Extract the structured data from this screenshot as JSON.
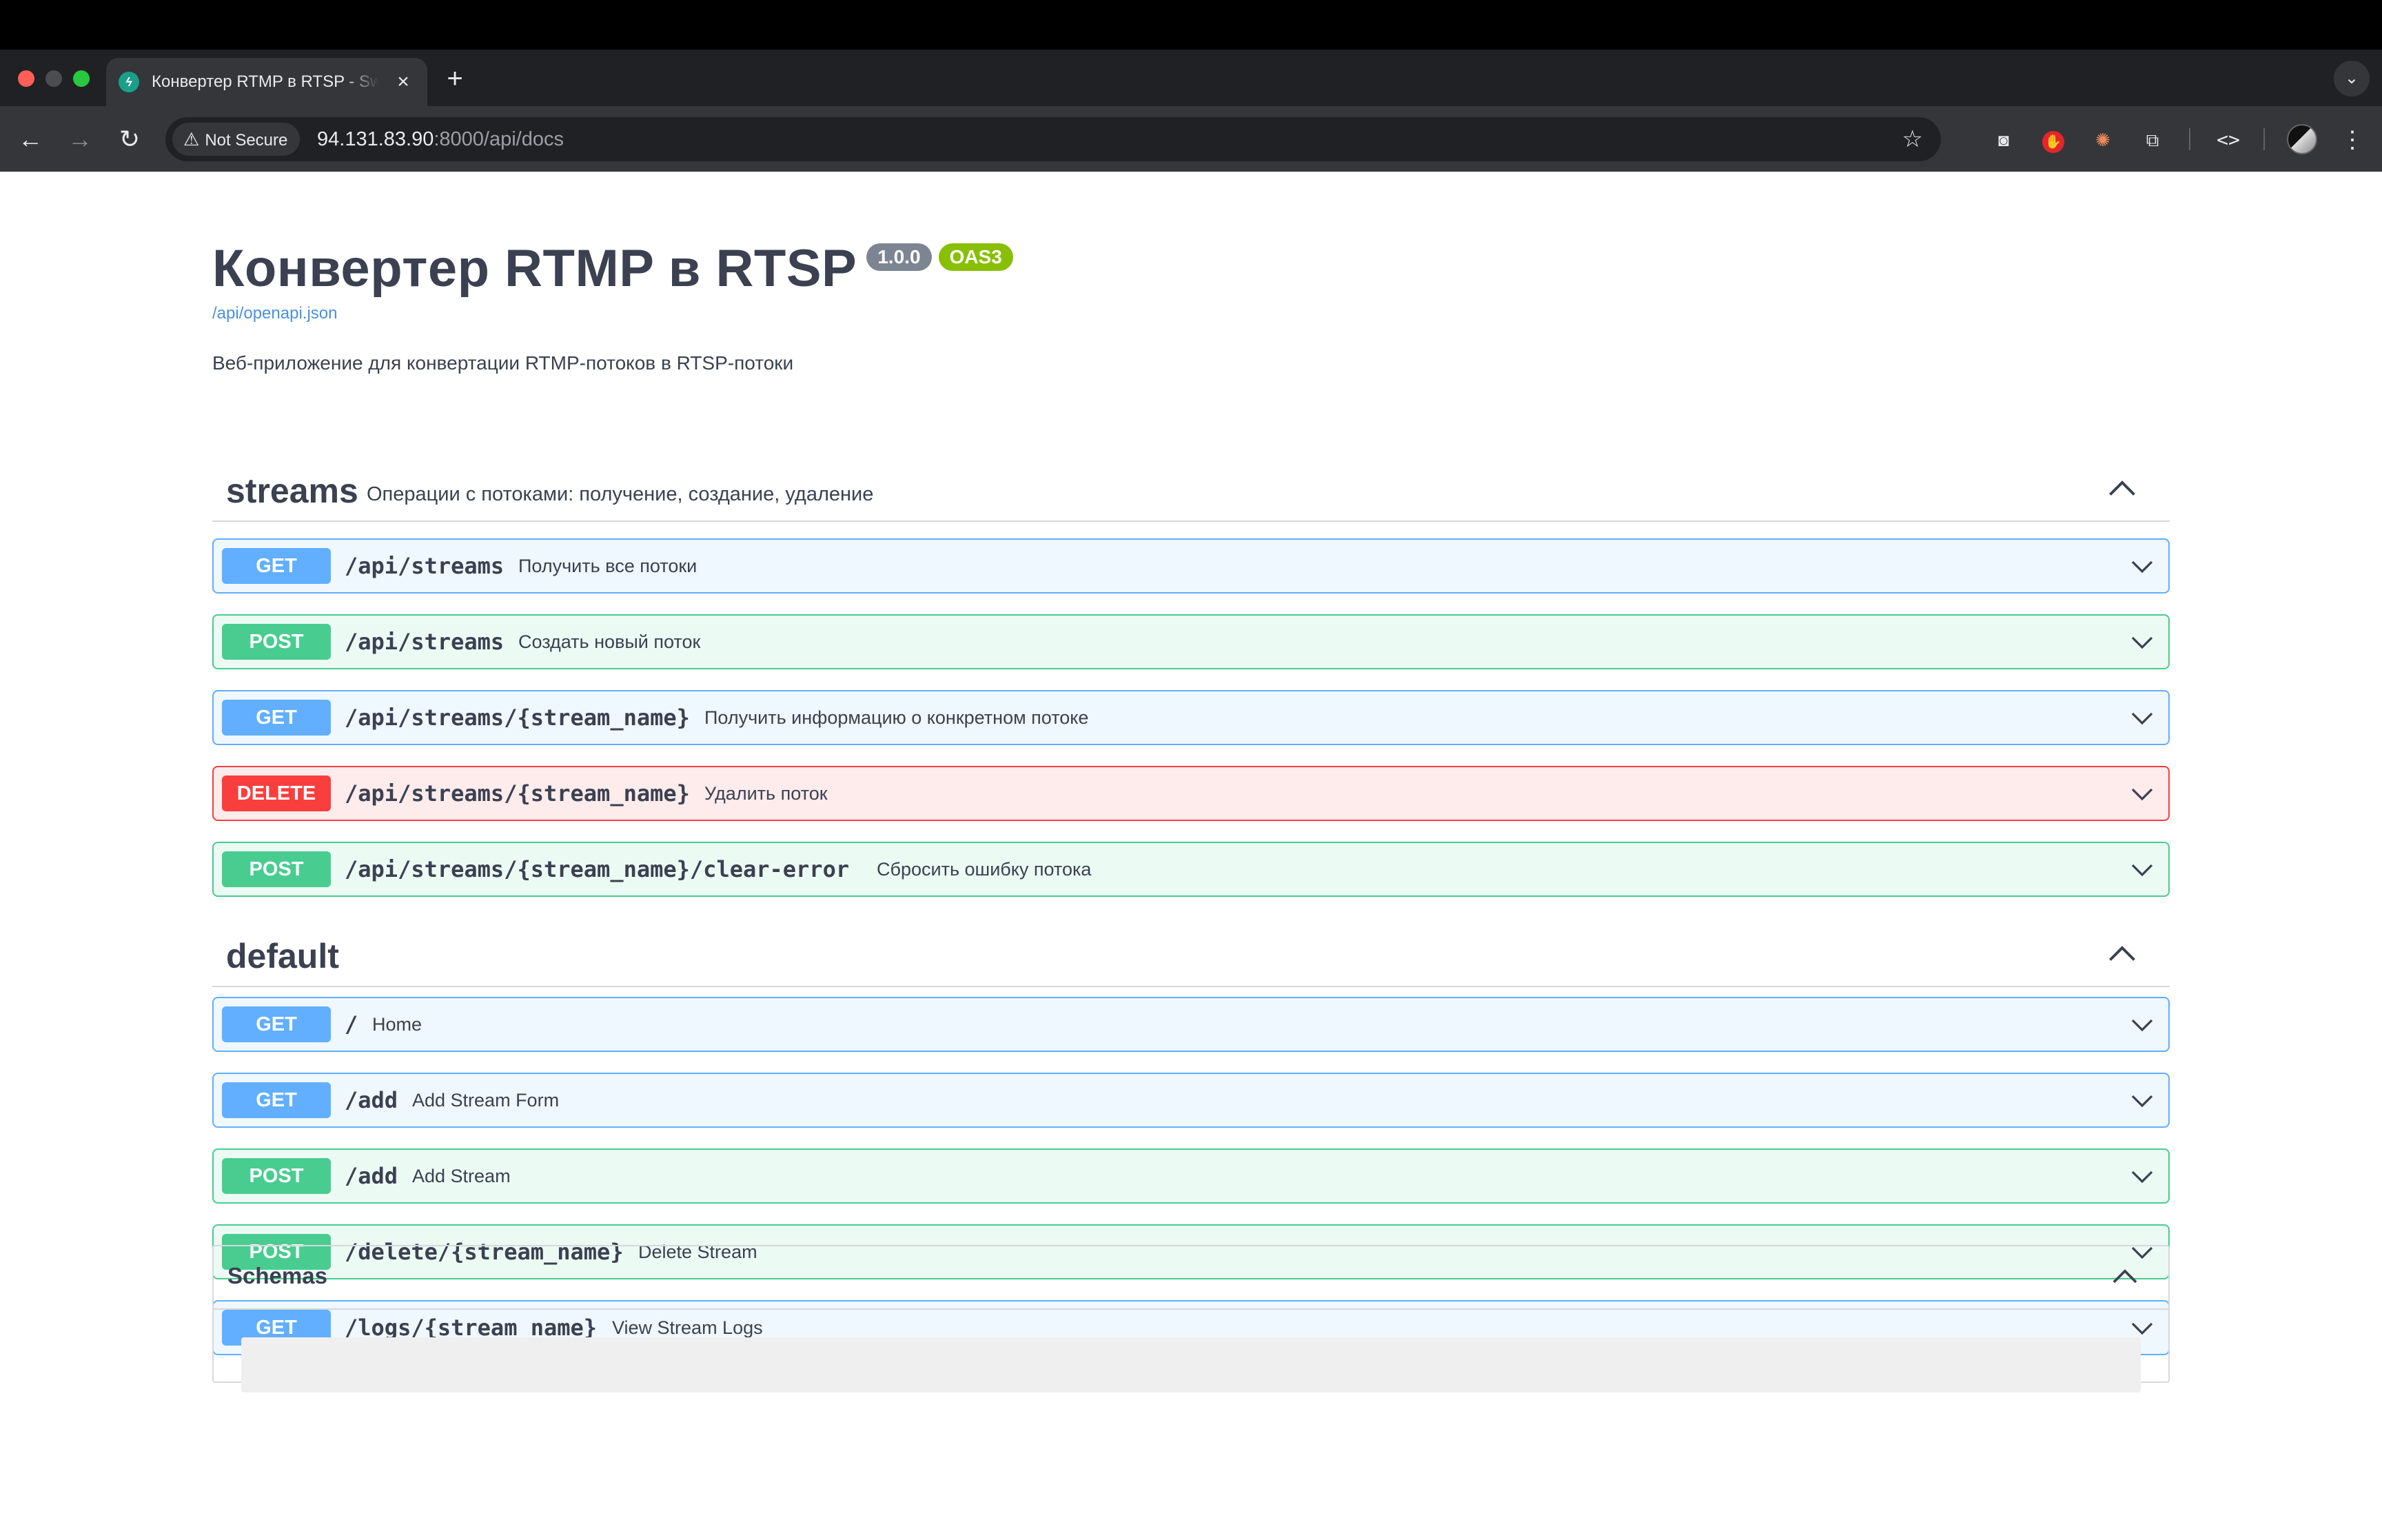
{
  "browser": {
    "tab_title": "Конвертер RTMP в RTSP - Swagger UI",
    "security_label": "Not Secure",
    "url_host": "94.131.83.90",
    "url_rest": ":8000/api/docs"
  },
  "info": {
    "title": "Конвертер RTMP в RTSP",
    "version": "1.0.0",
    "oas_badge": "OAS3",
    "spec_link": "/api/openapi.json",
    "description": "Веб-приложение для конвертации RTMP-потоков в RTSP-потоки"
  },
  "sections": [
    {
      "name": "streams",
      "description": "Операции с потоками: получение, создание, удаление",
      "operations": [
        {
          "method": "GET",
          "path": "/api/streams",
          "summary": "Получить все потоки"
        },
        {
          "method": "POST",
          "path": "/api/streams",
          "summary": "Создать новый поток"
        },
        {
          "method": "GET",
          "path": "/api/streams/{stream_name}",
          "summary": "Получить информацию о конкретном потоке"
        },
        {
          "method": "DELETE",
          "path": "/api/streams/{stream_name}",
          "summary": "Удалить поток"
        },
        {
          "method": "POST",
          "path": "/api/streams/{stream_name}/clear-error",
          "summary": "Сбросить ошибку потока"
        }
      ]
    },
    {
      "name": "default",
      "description": "",
      "operations": [
        {
          "method": "GET",
          "path": "/",
          "summary": "Home"
        },
        {
          "method": "GET",
          "path": "/add",
          "summary": "Add Stream Form"
        },
        {
          "method": "POST",
          "path": "/add",
          "summary": "Add Stream"
        },
        {
          "method": "POST",
          "path": "/delete/{stream_name}",
          "summary": "Delete Stream"
        },
        {
          "method": "GET",
          "path": "/logs/{stream_name}",
          "summary": "View Stream Logs"
        }
      ]
    }
  ],
  "schemas": {
    "title": "Schemas"
  },
  "colors": {
    "get": "#61affe",
    "post": "#49cc90",
    "delete": "#f93e3e",
    "version_badge": "#7d8492",
    "oas_badge": "#89bf04"
  }
}
